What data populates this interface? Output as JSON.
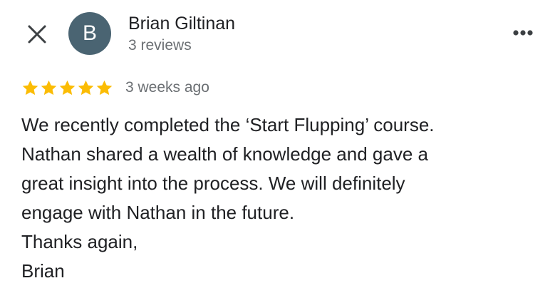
{
  "reviewer": {
    "avatar_initial": "B",
    "avatar_color": "#4a6472",
    "name": "Brian Giltinan",
    "review_count": "3 reviews"
  },
  "icons": {
    "close": "close-icon",
    "more": "more-options-icon",
    "star": "star-icon"
  },
  "rating": {
    "stars": 5,
    "max_stars": 5,
    "star_color": "#fbbc04",
    "time_ago": "3 weeks ago"
  },
  "review": {
    "lines": [
      "We recently completed the ‘Start Flupping’ course.",
      "Nathan shared a wealth of knowledge and gave a",
      "great insight into the process. We will definitely",
      "engage with Nathan in the future.",
      "Thanks again,",
      "Brian"
    ]
  }
}
